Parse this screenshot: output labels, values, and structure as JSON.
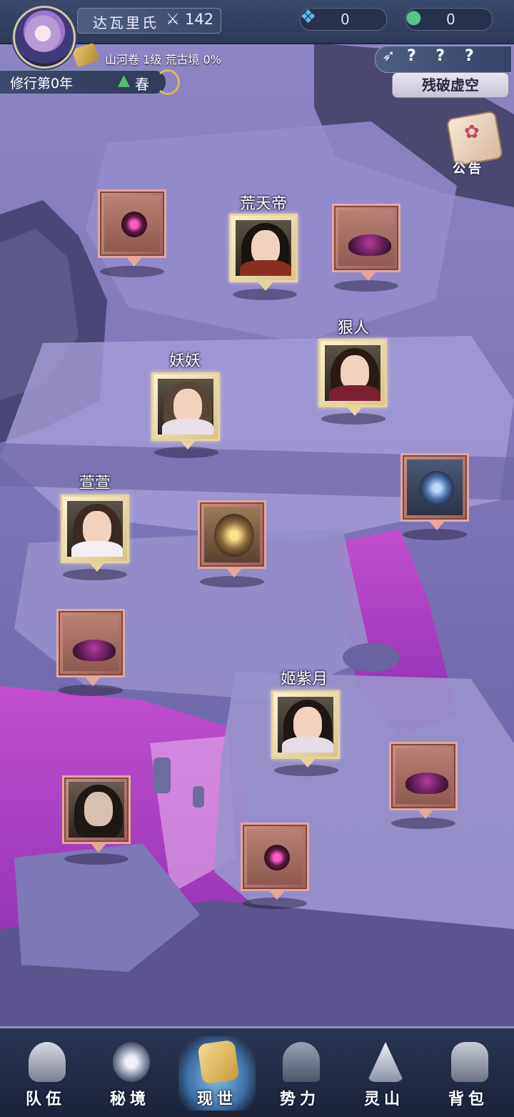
{
  "header": {
    "player_name": "达瓦里氏",
    "power_value": "142",
    "resource_crystal": "0",
    "resource_jade": "0",
    "volume_info": "山河卷 1级 荒古境 0%",
    "cultivation_year": "修行第0年",
    "season": "春"
  },
  "location": {
    "question_marks": "? ? ?",
    "name": "残破虚空"
  },
  "notice": {
    "label": "公告"
  },
  "npcs": [
    {
      "name": "荒天帝"
    },
    {
      "name": "狠人"
    },
    {
      "name": "妖妖"
    },
    {
      "name": "萱萱"
    },
    {
      "name": "姬紫月"
    }
  ],
  "nav": {
    "items": [
      {
        "label": "队伍"
      },
      {
        "label": "秘境"
      },
      {
        "label": "现世"
      },
      {
        "label": "势力"
      },
      {
        "label": "灵山"
      },
      {
        "label": "背包"
      }
    ],
    "active": "现世"
  },
  "icons": [
    "power-icon",
    "crystal-icon",
    "jade-icon",
    "scroll-icon",
    "tree-icon",
    "compass-arrow-icon",
    "notice-icon"
  ]
}
